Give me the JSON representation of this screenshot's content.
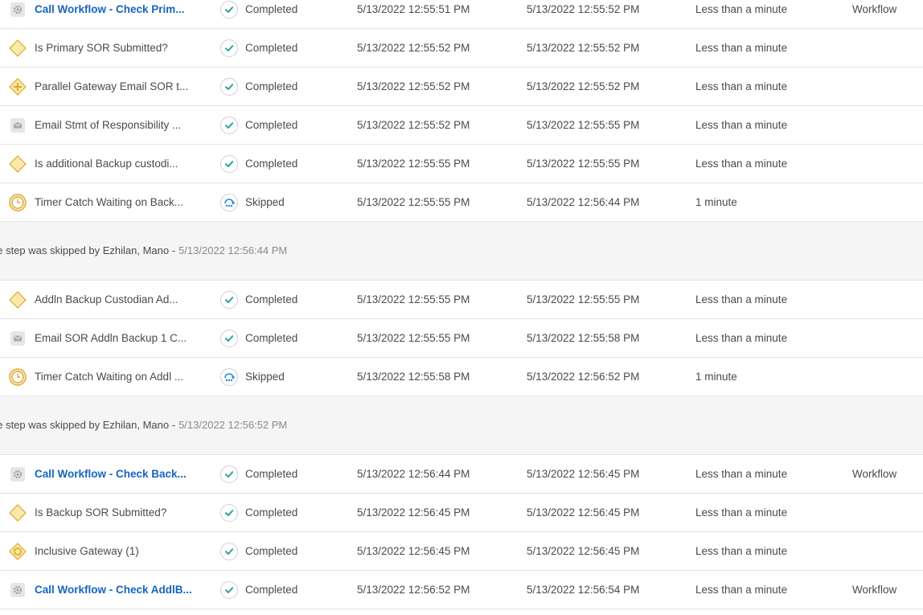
{
  "rows_top": [
    {
      "type": "call-workflow",
      "name": "Call Workflow - Check Prim...",
      "link": true,
      "status_kind": "completed",
      "status": "Completed",
      "start": "5/13/2022 12:55:51 PM",
      "end": "5/13/2022 12:55:52 PM",
      "duration": "Less than a minute",
      "category": "Workflow"
    },
    {
      "type": "decision",
      "name": "Is Primary SOR Submitted?",
      "link": false,
      "status_kind": "completed",
      "status": "Completed",
      "start": "5/13/2022 12:55:52 PM",
      "end": "5/13/2022 12:55:52 PM",
      "duration": "Less than a minute",
      "category": ""
    },
    {
      "type": "parallel-gateway",
      "name": "Parallel Gateway Email SOR t...",
      "link": false,
      "status_kind": "completed",
      "status": "Completed",
      "start": "5/13/2022 12:55:52 PM",
      "end": "5/13/2022 12:55:52 PM",
      "duration": "Less than a minute",
      "category": ""
    },
    {
      "type": "email",
      "name": "Email Stmt of Responsibility ...",
      "link": false,
      "status_kind": "completed",
      "status": "Completed",
      "start": "5/13/2022 12:55:52 PM",
      "end": "5/13/2022 12:55:55 PM",
      "duration": "Less than a minute",
      "category": ""
    },
    {
      "type": "decision",
      "name": "Is additional Backup custodi...",
      "link": false,
      "status_kind": "completed",
      "status": "Completed",
      "start": "5/13/2022 12:55:55 PM",
      "end": "5/13/2022 12:55:55 PM",
      "duration": "Less than a minute",
      "category": ""
    },
    {
      "type": "timer",
      "name": "Timer Catch Waiting on Back...",
      "link": false,
      "status_kind": "skipped",
      "status": "Skipped",
      "start": "5/13/2022 12:55:55 PM",
      "end": "5/13/2022 12:56:44 PM",
      "duration": "1 minute",
      "category": ""
    }
  ],
  "note1": {
    "text": "he step was skipped by Ezhilan, Mano -",
    "timestamp": "5/13/2022 12:56:44 PM"
  },
  "rows_mid": [
    {
      "type": "decision",
      "name": "Addln Backup Custodian Ad...",
      "link": false,
      "status_kind": "completed",
      "status": "Completed",
      "start": "5/13/2022 12:55:55 PM",
      "end": "5/13/2022 12:55:55 PM",
      "duration": "Less than a minute",
      "category": ""
    },
    {
      "type": "email",
      "name": "Email SOR Addln Backup 1 C...",
      "link": false,
      "status_kind": "completed",
      "status": "Completed",
      "start": "5/13/2022 12:55:55 PM",
      "end": "5/13/2022 12:55:58 PM",
      "duration": "Less than a minute",
      "category": ""
    },
    {
      "type": "timer",
      "name": "Timer Catch Waiting on Addl ...",
      "link": false,
      "status_kind": "skipped",
      "status": "Skipped",
      "start": "5/13/2022 12:55:58 PM",
      "end": "5/13/2022 12:56:52 PM",
      "duration": "1 minute",
      "category": ""
    }
  ],
  "note2": {
    "text": "he step was skipped by Ezhilan, Mano -",
    "timestamp": "5/13/2022 12:56:52 PM"
  },
  "rows_bottom": [
    {
      "type": "call-workflow",
      "name": "Call Workflow - Check Back...",
      "link": true,
      "status_kind": "completed",
      "status": "Completed",
      "start": "5/13/2022 12:56:44 PM",
      "end": "5/13/2022 12:56:45 PM",
      "duration": "Less than a minute",
      "category": "Workflow"
    },
    {
      "type": "decision",
      "name": "Is Backup SOR Submitted?",
      "link": false,
      "status_kind": "completed",
      "status": "Completed",
      "start": "5/13/2022 12:56:45 PM",
      "end": "5/13/2022 12:56:45 PM",
      "duration": "Less than a minute",
      "category": ""
    },
    {
      "type": "inclusive-gateway",
      "name": "Inclusive Gateway (1)",
      "link": false,
      "status_kind": "completed",
      "status": "Completed",
      "start": "5/13/2022 12:56:45 PM",
      "end": "5/13/2022 12:56:45 PM",
      "duration": "Less than a minute",
      "category": ""
    },
    {
      "type": "call-workflow",
      "name": "Call Workflow - Check AddlB...",
      "link": true,
      "status_kind": "completed",
      "status": "Completed",
      "start": "5/13/2022 12:56:52 PM",
      "end": "5/13/2022 12:56:54 PM",
      "duration": "Less than a minute",
      "category": "Workflow"
    }
  ],
  "colors": {
    "link": "#1565c0",
    "check": "#26a69a",
    "skip": "#1e88e5",
    "diamond": "#f2c94c",
    "timer": "#e0a82e",
    "gray_icon": "#bdbdbd"
  }
}
